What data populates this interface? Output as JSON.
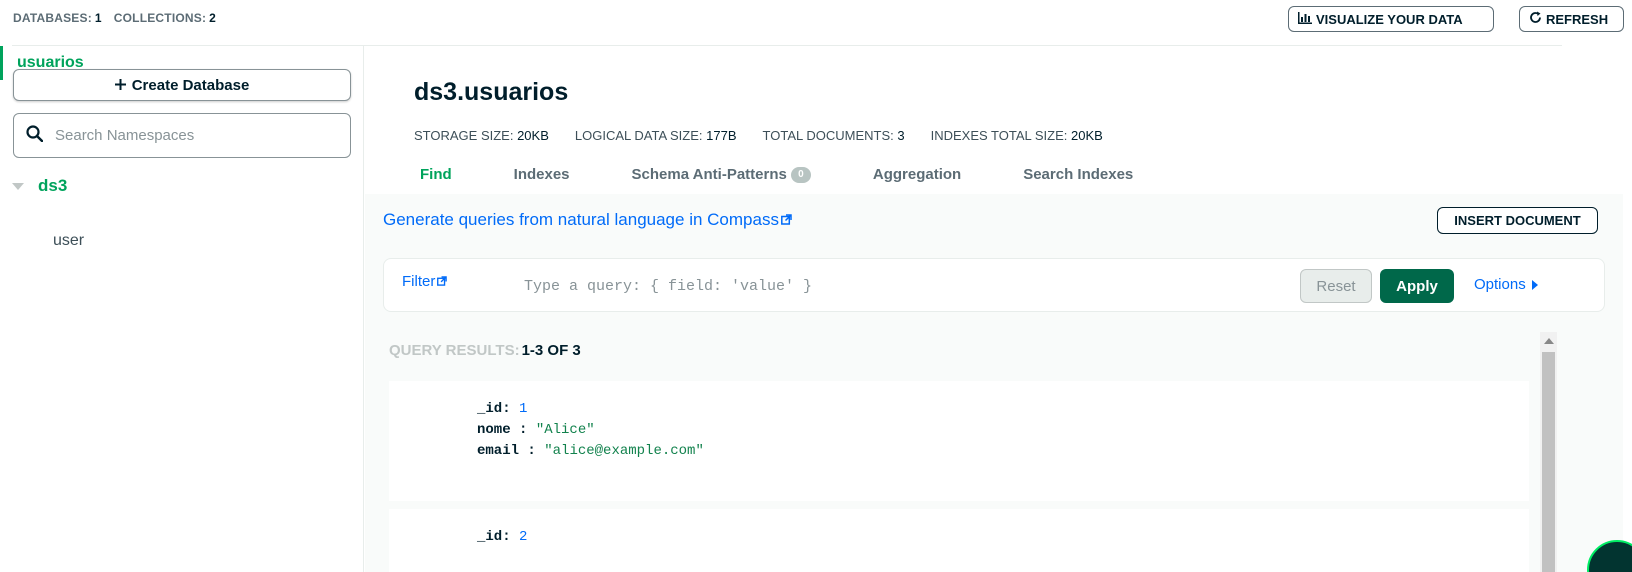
{
  "topbar": {
    "databases_label": "DATABASES:",
    "databases_count": "1",
    "collections_label": "COLLECTIONS:",
    "collections_count": "2",
    "visualize_label": "VISUALIZE YOUR DATA",
    "refresh_label": "REFRESH"
  },
  "sidebar": {
    "create_db_label": "Create Database",
    "search_placeholder": "Search Namespaces",
    "database": "ds3",
    "collections": [
      "user",
      "usuarios"
    ],
    "active_collection": "usuarios"
  },
  "main": {
    "title": "ds3.usuarios",
    "metrics": [
      {
        "label": "STORAGE SIZE:",
        "value": "20KB"
      },
      {
        "label": "LOGICAL DATA SIZE:",
        "value": "177B"
      },
      {
        "label": "TOTAL DOCUMENTS:",
        "value": "3"
      },
      {
        "label": "INDEXES TOTAL SIZE:",
        "value": "20KB"
      }
    ],
    "tabs": [
      {
        "label": "Find",
        "active": true
      },
      {
        "label": "Indexes"
      },
      {
        "label": "Schema Anti-Patterns",
        "badge": "0"
      },
      {
        "label": "Aggregation"
      },
      {
        "label": "Search Indexes"
      }
    ],
    "nl_link": "Generate queries from natural language in Compass",
    "insert_label": "INSERT DOCUMENT",
    "filter": {
      "label": "Filter",
      "placeholder": "Type a query: { field: 'value' }",
      "reset_label": "Reset",
      "apply_label": "Apply",
      "options_label": "Options"
    },
    "query_results_label": "QUERY RESULTS:",
    "query_results_range": "1-3 OF 3",
    "documents": [
      {
        "id_key": "_id",
        "id": "1",
        "nome_key": "nome",
        "nome": "\"Alice\"",
        "email_key": "email",
        "email": "\"alice@example.com\""
      },
      {
        "id_key": "_id",
        "id": "2"
      }
    ]
  },
  "colors": {
    "accent_green": "#00a35c",
    "apply_green": "#00684a",
    "link_blue": "#016bf8"
  }
}
